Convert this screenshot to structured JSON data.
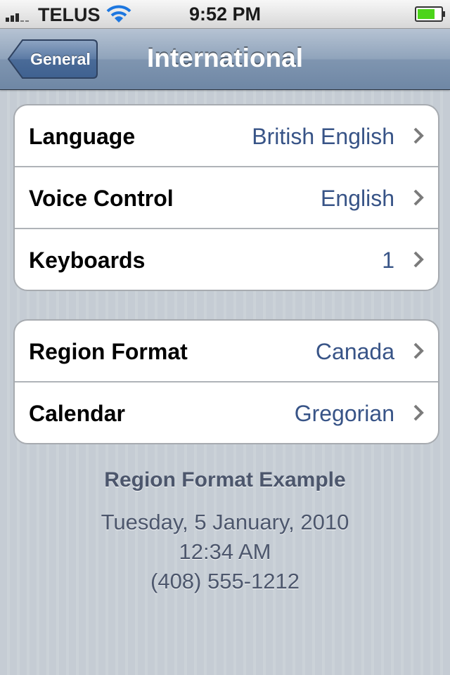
{
  "status_bar": {
    "carrier": "TELUS",
    "time": "9:52 PM",
    "signal_bars": 3,
    "battery_level": 0.75,
    "icons": [
      "signal-icon",
      "wifi-icon",
      "battery-icon"
    ]
  },
  "nav": {
    "back_label": "General",
    "title": "International"
  },
  "groups": [
    {
      "rows": [
        {
          "label": "Language",
          "value": "British English"
        },
        {
          "label": "Voice Control",
          "value": "English"
        },
        {
          "label": "Keyboards",
          "value": "1"
        }
      ]
    },
    {
      "rows": [
        {
          "label": "Region Format",
          "value": "Canada"
        },
        {
          "label": "Calendar",
          "value": "Gregorian"
        }
      ]
    }
  ],
  "example": {
    "title": "Region Format Example",
    "date": "Tuesday, 5 January, 2010",
    "time": "12:34 AM",
    "phone": "(408) 555-1212"
  },
  "colors": {
    "value_text": "#385487",
    "nav_bar": "#6f87a5",
    "background": "#c5ccd4",
    "battery_fill": "#4cd41a"
  }
}
